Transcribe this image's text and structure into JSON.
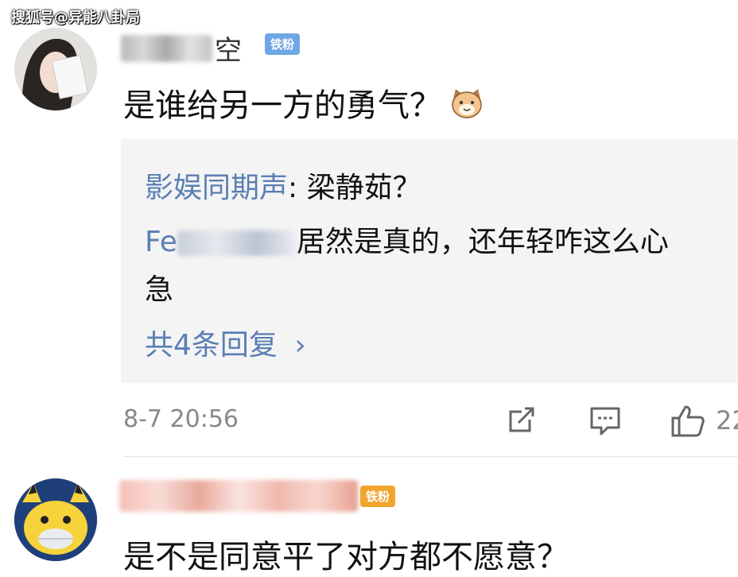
{
  "watermark": "搜狐号@异能八卦局",
  "comment1": {
    "name_tail": "空",
    "badge": "铁粉",
    "text": "是谁给另一方的勇气？",
    "emoji": "cat-face-icon",
    "replies": {
      "reply1_author": "影娱同期声",
      "reply1_sep": ": ",
      "reply1_text": "梁静茹？",
      "reply2_author_partial": "Fe",
      "reply2_text": "居然是真的，还年轻咋这么心",
      "reply2_text_cont": "急",
      "more_label": "共4条回复",
      "more_chevron": "›"
    },
    "time": "8-7 20:56",
    "likes_partial": "22"
  },
  "comment2": {
    "badge": "铁粉",
    "text": "是不是同意平了对方都不愿意？"
  },
  "colors": {
    "link_blue": "#5b7fb3",
    "badge_blue": "#6fa6e6",
    "badge_orange": "#f0a52d",
    "reply_bg": "#f4f4f4"
  }
}
